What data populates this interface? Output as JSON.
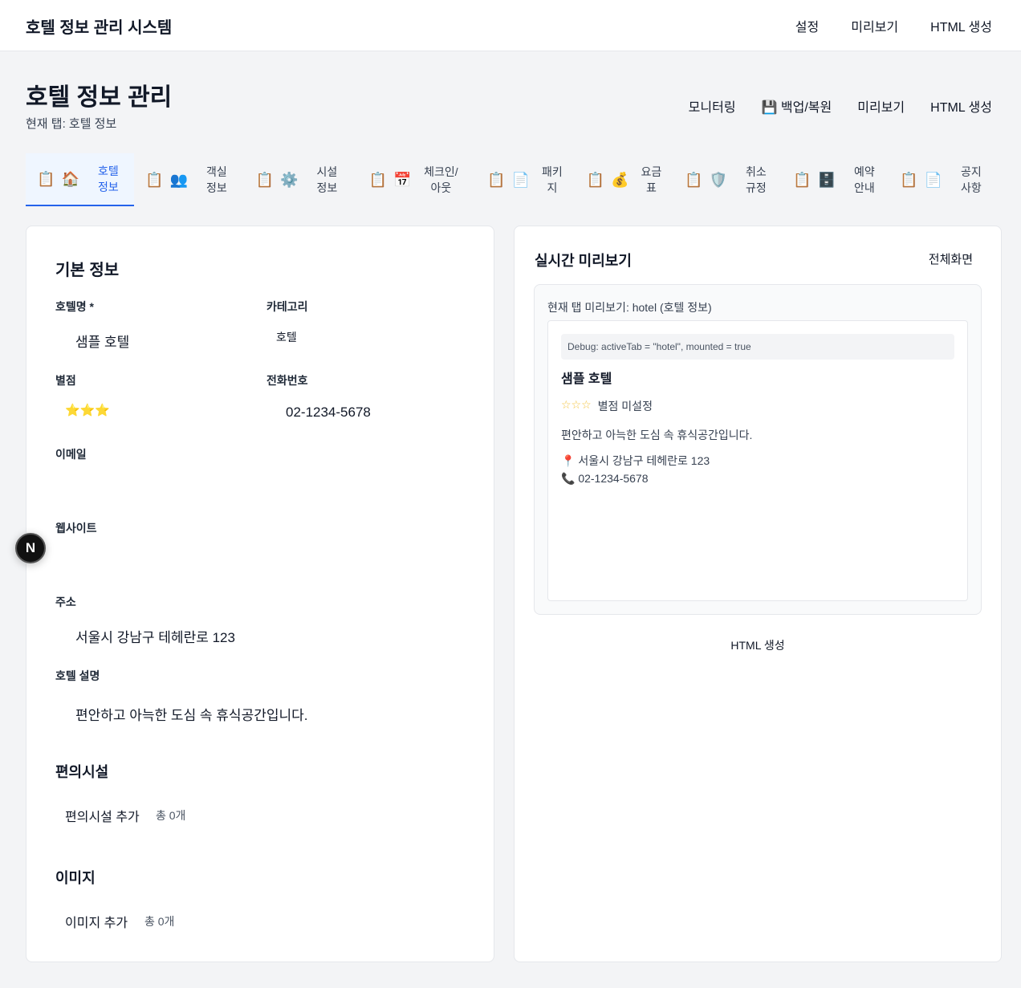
{
  "header": {
    "app_title": "호텔 정보 관리 시스템",
    "nav": [
      "설정",
      "미리보기",
      "HTML 생성"
    ]
  },
  "page": {
    "title": "호텔 정보 관리",
    "subtitle": "현재 탭: 호텔 정보",
    "actions": {
      "monitoring": "모니터링",
      "backup": "💾 백업/복원",
      "preview": "미리보기",
      "html": "HTML 생성"
    }
  },
  "tabs": [
    {
      "icon": "🏠",
      "label": "호텔 정보",
      "active": true
    },
    {
      "icon": "👥",
      "label": "객실 정보"
    },
    {
      "icon": "⚙️",
      "label": "시설 정보"
    },
    {
      "icon": "📅",
      "label": "체크인/아웃"
    },
    {
      "icon": "📄",
      "label": "패키지"
    },
    {
      "icon": "💰",
      "label": "요금표"
    },
    {
      "icon": "🛡️",
      "label": "취소 규정"
    },
    {
      "icon": "🗄️",
      "label": "예약 안내"
    },
    {
      "icon": "📄",
      "label": "공지 사항"
    }
  ],
  "tab_prefix_icon": "📋",
  "form": {
    "section_basic": "기본 정보",
    "name_label": "호텔명 *",
    "name_value": "샘플 호텔",
    "category_label": "카테고리",
    "category_value": "호텔",
    "stars_label": "별점",
    "stars_value": "⭐⭐⭐",
    "phone_label": "전화번호",
    "phone_value": "02-1234-5678",
    "email_label": "이메일",
    "website_label": "웹사이트",
    "address_label": "주소",
    "address_value": "서울시 강남구 테헤란로 123",
    "desc_label": "호텔 설명",
    "desc_value": "편안하고 아늑한 도심 속 휴식공간입니다.",
    "section_amenities": "편의시설",
    "amenities_add": "편의시설 추가",
    "amenities_count": "총 0개",
    "section_images": "이미지",
    "images_add": "이미지 추가",
    "images_count": "총 0개"
  },
  "preview": {
    "title": "실시간 미리보기",
    "fullscreen": "전체화면",
    "caption": "현재 탭 미리보기: hotel (호텔 정보)",
    "debug": "Debug: activeTab = \"hotel\", mounted = true",
    "hotel_name": "샘플 호텔",
    "stars": "☆☆☆",
    "stars_text": "별점 미설정",
    "description": "편안하고 아늑한 도심 속 휴식공간입니다.",
    "address": "📍 서울시 강남구 테헤란로 123",
    "phone": "📞 02-1234-5678",
    "html_button": "HTML 생성"
  },
  "badge": "N"
}
